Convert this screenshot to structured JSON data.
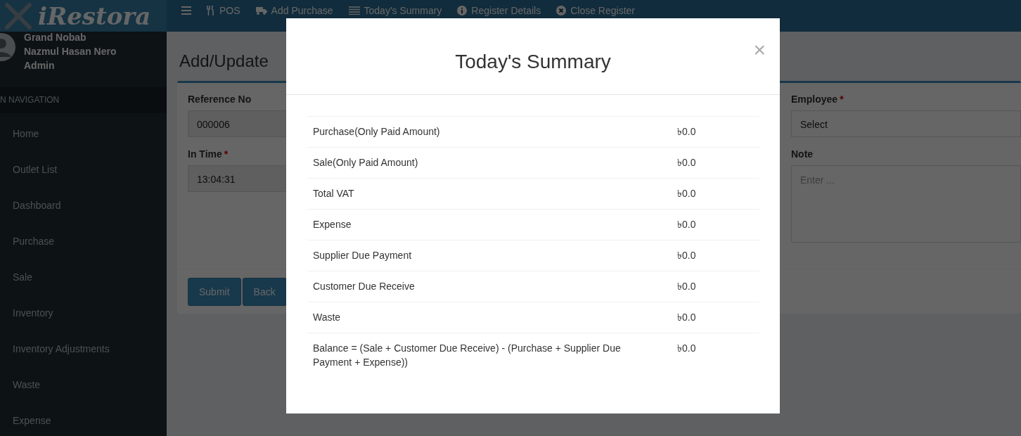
{
  "logo": {
    "text": "iRestora"
  },
  "navbar": {
    "items": [
      {
        "label": "POS"
      },
      {
        "label": "Add Purchase"
      },
      {
        "label": "Today's Summary"
      },
      {
        "label": "Register Details"
      },
      {
        "label": "Close Register"
      }
    ]
  },
  "user_panel": {
    "lines": [
      "Grand Nobab",
      "Nazmul Hasan Nero",
      "Admin"
    ]
  },
  "sidebar": {
    "header": "N NAVIGATION",
    "items": [
      "Home",
      "Outlet List",
      "Dashboard",
      "Purchase",
      "Sale",
      "Inventory",
      "Inventory Adjustments",
      "Waste",
      "Expense"
    ]
  },
  "page": {
    "title": "Add/Update",
    "left_fields": [
      {
        "label": "Reference No",
        "value": "000006"
      },
      {
        "label": "In Time",
        "required_mark": "*",
        "value": "13:04:31"
      }
    ],
    "right_fields": [
      {
        "label": "Employee",
        "required_mark": "*",
        "kind": "select",
        "value": "Select"
      },
      {
        "label": "Note",
        "kind": "textarea",
        "placeholder": "Enter ..."
      }
    ],
    "buttons": [
      "Submit",
      "Back"
    ]
  },
  "modal": {
    "title": "Today's Summary",
    "close": "×",
    "rows": [
      {
        "label": "Purchase(Only Paid Amount)",
        "value": "৳0.0"
      },
      {
        "label": "Sale(Only Paid Amount)",
        "value": "৳0.0"
      },
      {
        "label": "Total VAT",
        "value": "৳0.0"
      },
      {
        "label": "Expense",
        "value": "৳0.0"
      },
      {
        "label": "Supplier Due Payment",
        "value": "৳0.0"
      },
      {
        "label": "Customer Due Receive",
        "value": "৳0.0"
      },
      {
        "label": "Waste",
        "value": "৳0.0"
      },
      {
        "label": "Balance = (Sale + Customer Due Receive) - (Purchase + Supplier Due Payment + Expense))",
        "value": "৳0.0"
      }
    ]
  }
}
